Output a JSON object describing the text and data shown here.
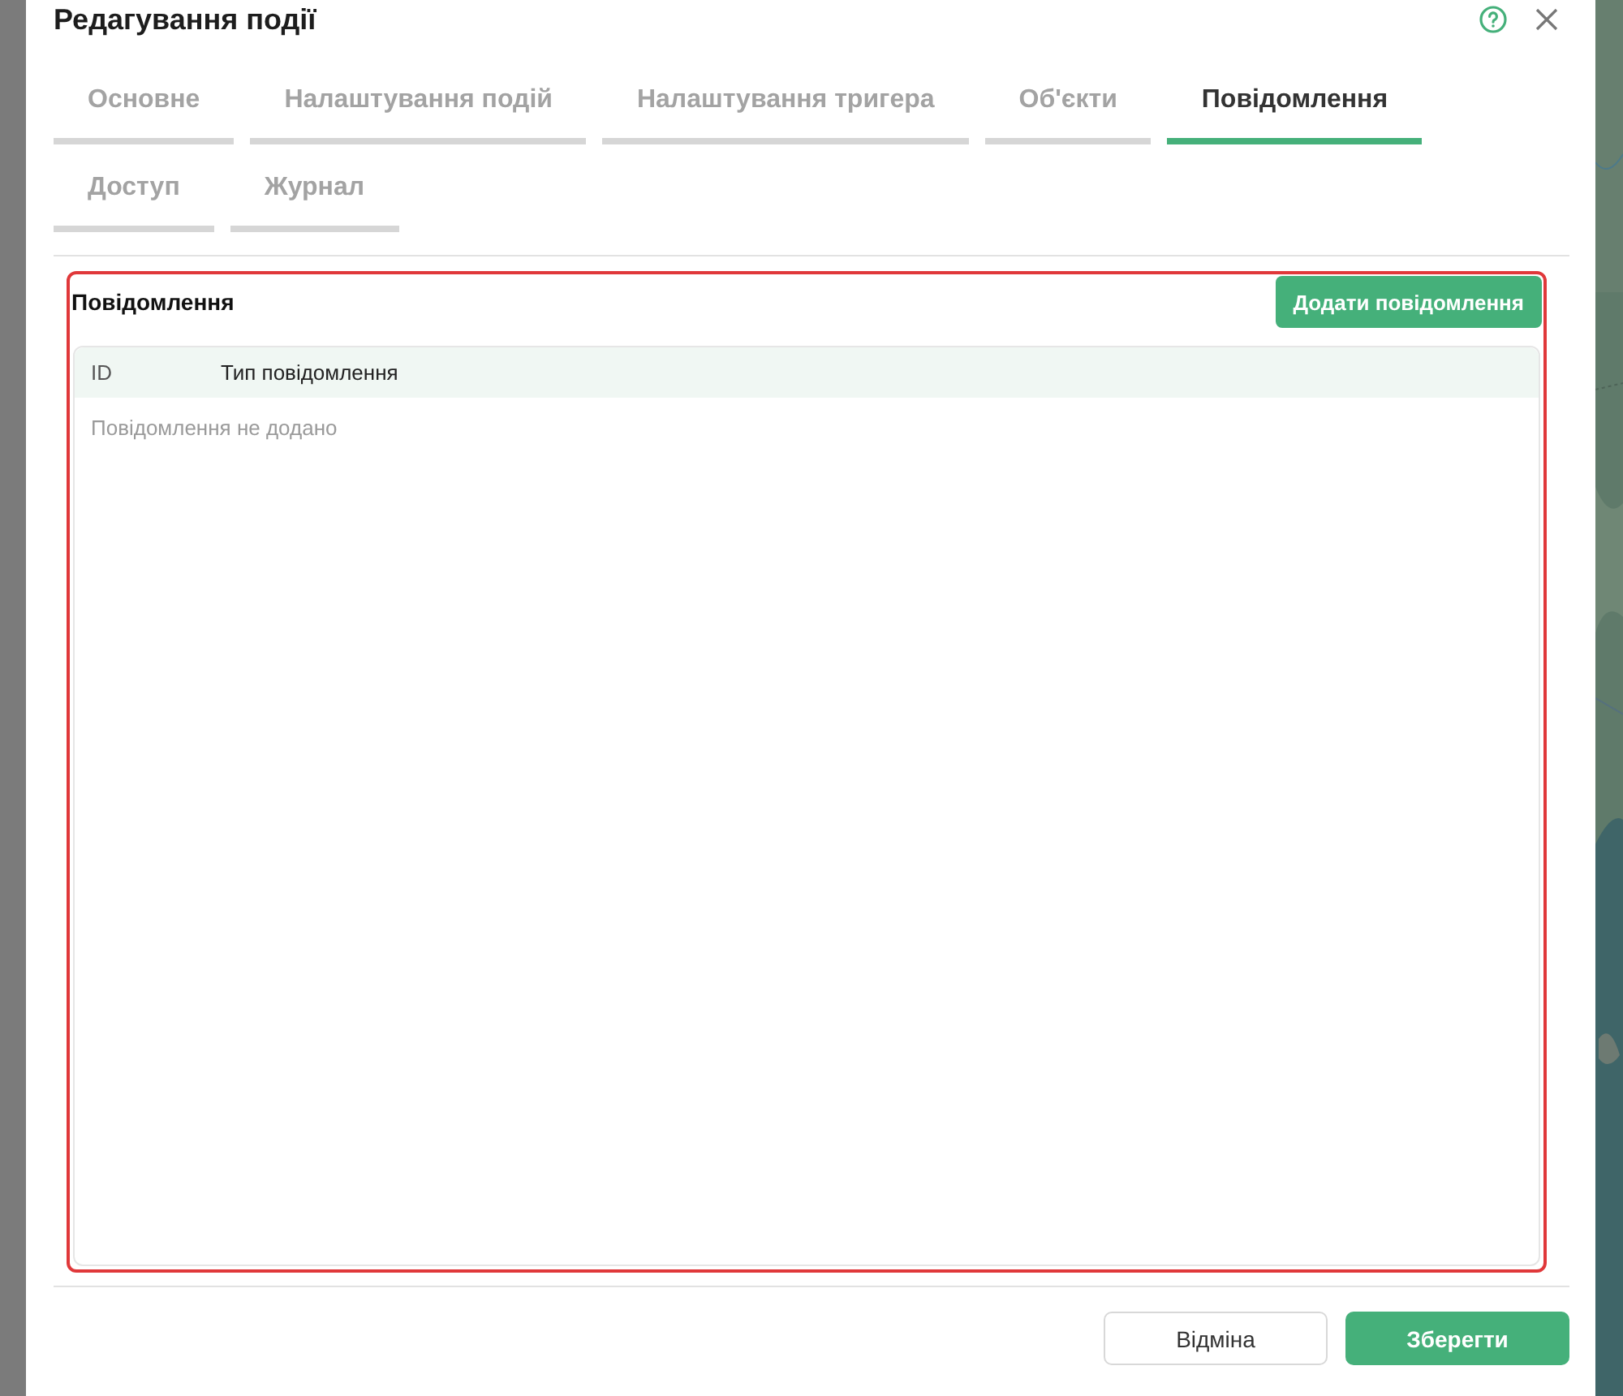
{
  "dialog": {
    "title": "Редагування події"
  },
  "tabs": [
    {
      "label": "Основне",
      "selected": false
    },
    {
      "label": "Налаштування подій",
      "selected": false
    },
    {
      "label": "Налаштування тригера",
      "selected": false
    },
    {
      "label": "Об'єкти",
      "selected": false
    },
    {
      "label": "Повідомлення",
      "selected": true
    },
    {
      "label": "Доступ",
      "selected": false
    },
    {
      "label": "Журнал",
      "selected": false
    }
  ],
  "section": {
    "title": "Повідомлення",
    "add_button": "Додати повідомлення",
    "highlighted": true,
    "table": {
      "columns": [
        "ID",
        "Тип повідомлення"
      ],
      "empty_text": "Повідомлення не додано"
    }
  },
  "footer": {
    "cancel_button": "Відміна",
    "save_button": "Зберегти"
  }
}
